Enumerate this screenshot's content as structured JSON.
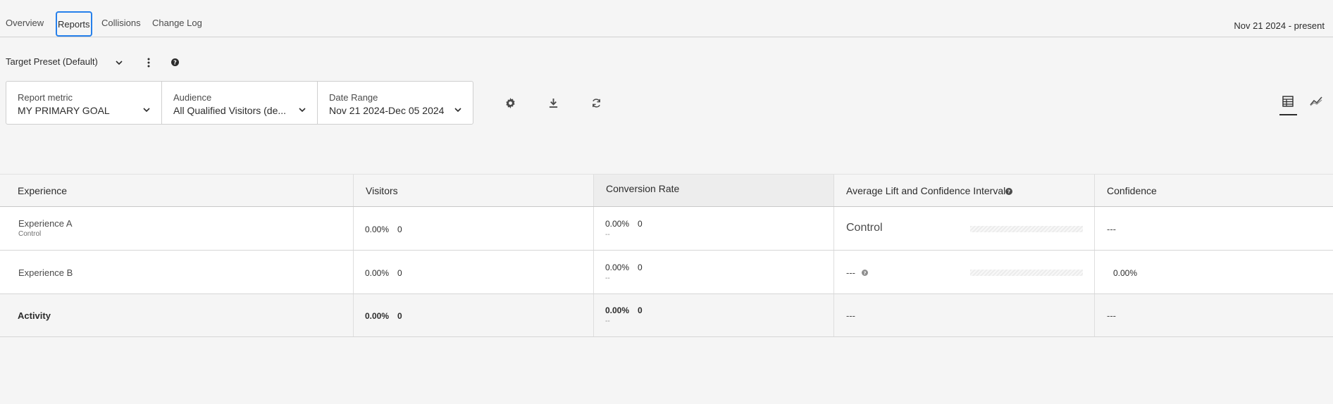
{
  "tabs": [
    {
      "label": "Overview"
    },
    {
      "label": "Reports"
    },
    {
      "label": "Collisions"
    },
    {
      "label": "Change Log"
    }
  ],
  "date_range_top": "Nov 21 2024 - present",
  "preset": {
    "label": "Target Preset (Default)"
  },
  "filters": {
    "report_metric": {
      "label": "Report metric",
      "value": "MY PRIMARY GOAL"
    },
    "audience": {
      "label": "Audience",
      "value": "All Qualified Visitors (de..."
    },
    "date_range": {
      "label": "Date Range",
      "value": "Nov 21 2024-Dec 05 2024"
    }
  },
  "icons": {
    "settings": "gear-icon",
    "download": "download-icon",
    "refresh": "refresh-icon",
    "table_view": "table-view-icon",
    "graph_view": "graph-view-icon",
    "help": "help-icon"
  },
  "table": {
    "headers": {
      "experience": "Experience",
      "visitors": "Visitors",
      "conversion_rate": "Conversion Rate",
      "lift": "Average Lift and Confidence Interval",
      "confidence": "Confidence"
    },
    "rows": [
      {
        "name": "Experience A",
        "sub": "Control",
        "visitors_pct": "0.00%",
        "visitors_count": "0",
        "conv_pct": "0.00%",
        "conv_count": "0",
        "conv_sub": "--",
        "lift": "Control",
        "confidence": "---"
      },
      {
        "name": "Experience B",
        "sub": "",
        "visitors_pct": "0.00%",
        "visitors_count": "0",
        "conv_pct": "0.00%",
        "conv_count": "0",
        "conv_sub": "--",
        "lift": "---",
        "confidence": "0.00%"
      }
    ],
    "activity": {
      "name": "Activity",
      "visitors_pct": "0.00%",
      "visitors_count": "0",
      "conv_pct": "0.00%",
      "conv_count": "0",
      "conv_sub": "--",
      "lift": "---",
      "confidence": "---"
    }
  },
  "colors": {
    "accent": "#2680eb",
    "background": "#f5f5f5"
  }
}
